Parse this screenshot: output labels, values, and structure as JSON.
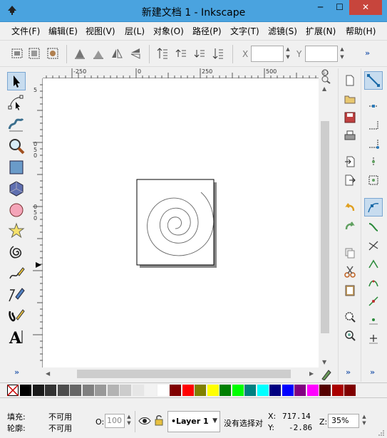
{
  "window": {
    "title": "新建文档 1 - Inkscape",
    "min_glyph": "─",
    "max_glyph": "☐",
    "close_glyph": "✕"
  },
  "menu": [
    "文件(F)",
    "编辑(E)",
    "视图(V)",
    "层(L)",
    "对象(O)",
    "路径(P)",
    "文字(T)",
    "滤镜(S)",
    "扩展(N)",
    "帮助(H)"
  ],
  "toolbar": {
    "x_label": "X",
    "y_label": "Y",
    "x_value": "",
    "y_value": "",
    "more": "»"
  },
  "rulers": {
    "top": [
      "-250",
      "0",
      "250",
      "500"
    ],
    "left": [
      "5",
      "0",
      "5",
      "0",
      "0",
      "5",
      "0"
    ]
  },
  "toolbox": {
    "more": "»",
    "tools": [
      "selector-tool",
      "node-tool",
      "tweak-tool",
      "zoom-tool",
      "rectangle-tool",
      "3d-box-tool",
      "ellipse-tool",
      "star-tool",
      "spiral-tool",
      "pencil-tool",
      "pen-tool",
      "calligraphy-tool",
      "text-tool"
    ]
  },
  "palette_colors": [
    "#000000",
    "#1a1a1a",
    "#333333",
    "#4d4d4d",
    "#666666",
    "#808080",
    "#999999",
    "#b3b3b3",
    "#cccccc",
    "#e6e6e6",
    "#f2f2f2",
    "#ffffff",
    "#800000",
    "#ff0000",
    "#808000",
    "#ffff00",
    "#008000",
    "#00ff00",
    "#008080",
    "#00ffff",
    "#000080",
    "#0000ff",
    "#800080",
    "#ff00ff",
    "#550000",
    "#aa0000",
    "#800000"
  ],
  "status": {
    "fill_label": "填充:",
    "fill_value": "不可用",
    "stroke_label": "轮廓:",
    "stroke_value": "不可用",
    "opacity_label": "O:",
    "opacity_value": "100",
    "layer": "•Layer 1",
    "message": "没有选择对",
    "x_label": "X:",
    "x_value": "717.14",
    "y_label": "Y:",
    "y_value": "-2.86",
    "zoom_label": "Z:",
    "zoom_value": "35%"
  },
  "right_more": "»",
  "snap_more": "»",
  "colors": {
    "titlebar": "#4aa3df",
    "close": "#c7453c",
    "active_tool": "#c7dcef"
  }
}
